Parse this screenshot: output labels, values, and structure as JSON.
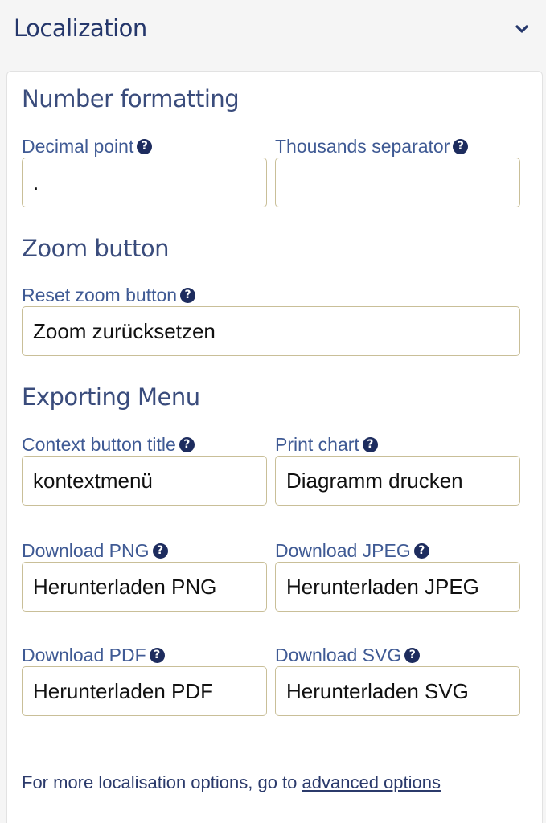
{
  "header": {
    "title": "Localization",
    "toggle_icon": "chevron-down-icon"
  },
  "sections": {
    "number": {
      "title": "Number formatting",
      "decimal_point": {
        "label": "Decimal point",
        "value": "."
      },
      "thousands_separator": {
        "label": "Thousands separator",
        "value": ""
      }
    },
    "zoom": {
      "title": "Zoom button",
      "reset_zoom": {
        "label": "Reset zoom button",
        "value": "Zoom zurücksetzen"
      }
    },
    "exporting": {
      "title": "Exporting Menu",
      "context_button_title": {
        "label": "Context button title",
        "value": "kontextmenü"
      },
      "print_chart": {
        "label": "Print chart",
        "value": "Diagramm drucken"
      },
      "download_png": {
        "label": "Download PNG",
        "value": "Herunterladen PNG"
      },
      "download_jpeg": {
        "label": "Download JPEG",
        "value": "Herunterladen JPEG"
      },
      "download_pdf": {
        "label": "Download PDF",
        "value": "Herunterladen PDF"
      },
      "download_svg": {
        "label": "Download SVG",
        "value": "Herunterladen SVG"
      }
    }
  },
  "help_icon": {
    "glyph": "?"
  },
  "footer": {
    "text": "For more localisation options, go to ",
    "link": "advanced options"
  },
  "colors": {
    "heading": "#25376b",
    "label": "#3f5a94",
    "field_border": "#c9bf98",
    "help_icon_bg": "#1d2c5e"
  }
}
